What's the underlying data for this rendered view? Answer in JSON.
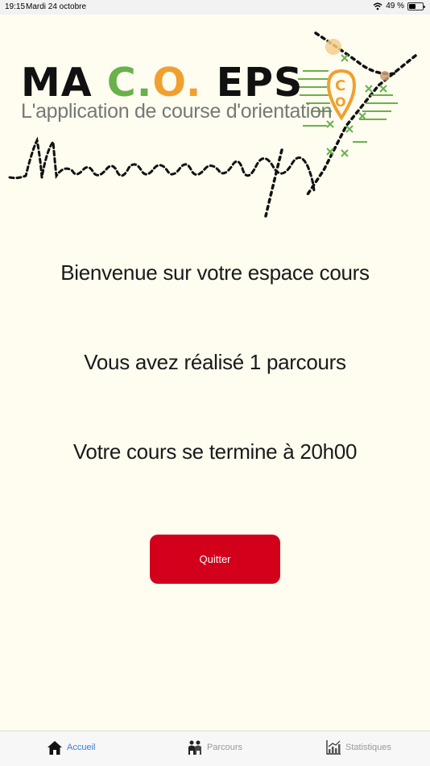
{
  "status_bar": {
    "time": "19:15",
    "date": "Mardi 24 octobre",
    "battery": "49 %",
    "battery_level": 0.49
  },
  "logo": {
    "title_ma": "MA ",
    "title_c": "C.",
    "title_o": "O.",
    "title_eps": " EPS",
    "subtitle": "L'application de course d'orientation",
    "signature": "Ma co eps",
    "colors": {
      "black": "#111111",
      "green": "#6ab04c",
      "orange": "#f0a030"
    }
  },
  "main": {
    "welcome": "Bienvenue sur votre espace cours",
    "courses_done": "Vous avez réalisé 1 parcours",
    "end_time": "Votre cours se termine à 20h00",
    "quit_label": "Quitter"
  },
  "tabs": [
    {
      "label": "Accueil",
      "icon": "home-icon",
      "active": true
    },
    {
      "label": "Parcours",
      "icon": "people-icon",
      "active": false
    },
    {
      "label": "Statistiques",
      "icon": "chart-icon",
      "active": false
    }
  ],
  "colors": {
    "accent": "#3a7bd5",
    "button": "#d3001c",
    "background": "#fefdf0"
  }
}
